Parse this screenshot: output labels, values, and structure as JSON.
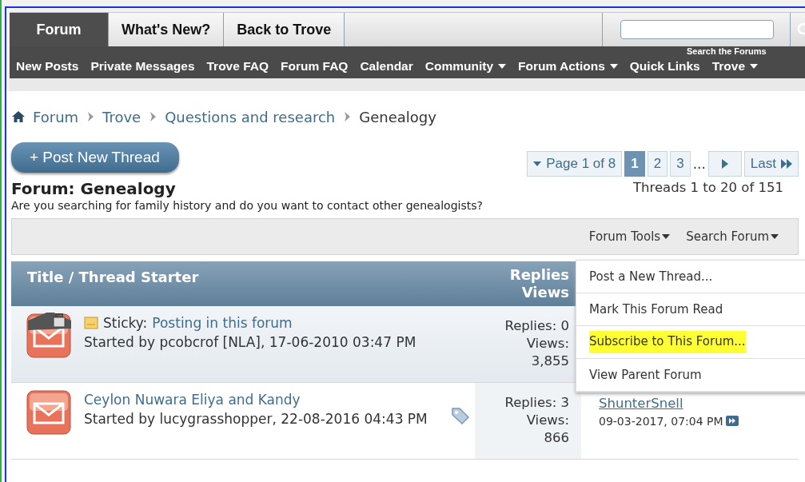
{
  "tabs": [
    {
      "label": "Forum",
      "selected": true
    },
    {
      "label": "What's New?",
      "selected": false
    },
    {
      "label": "Back to Trove",
      "selected": false
    }
  ],
  "search": {
    "overlay_label": "Search the Forums"
  },
  "nav": [
    {
      "label": "New Posts",
      "dropdown": false
    },
    {
      "label": "Private Messages",
      "dropdown": false
    },
    {
      "label": "Trove FAQ",
      "dropdown": false
    },
    {
      "label": "Forum FAQ",
      "dropdown": false
    },
    {
      "label": "Calendar",
      "dropdown": false
    },
    {
      "label": "Community",
      "dropdown": true
    },
    {
      "label": "Forum Actions",
      "dropdown": true
    },
    {
      "label": "Quick Links",
      "dropdown": false
    },
    {
      "label": "Trove",
      "dropdown": true
    }
  ],
  "breadcrumbs": [
    {
      "label": "Forum",
      "link": true
    },
    {
      "label": "Trove",
      "link": true
    },
    {
      "label": "Questions and research",
      "link": true
    },
    {
      "label": "Genealogy",
      "link": false
    }
  ],
  "post_button": "+ Post New Thread",
  "pagination": {
    "summary": "Page 1 of 8",
    "pages": [
      {
        "label": "1",
        "selected": true
      },
      {
        "label": "2",
        "selected": false
      },
      {
        "label": "3",
        "selected": false
      }
    ],
    "ellipsis": "...",
    "last": "Last",
    "range": "Threads 1 to 20 of 151"
  },
  "forum": {
    "title": "Forum: Genealogy",
    "description": "Are you searching for family history and do you want to contact other genealogists?"
  },
  "toolbar": [
    "Forum Tools",
    "Search Forum"
  ],
  "menu": [
    {
      "label": "Post a New Thread...",
      "highlighted": false
    },
    {
      "label": "Mark This Forum Read",
      "highlighted": false
    },
    {
      "label": "Subscribe to This Forum...",
      "highlighted": true
    },
    {
      "label": "View Parent Forum",
      "highlighted": false
    }
  ],
  "table": {
    "columns": [
      "Title / Thread Starter",
      "Replies",
      "Views"
    ],
    "rows": [
      {
        "sticky": true,
        "prefix": "Sticky:",
        "title": "Posting in this forum",
        "starter": "Started by pcobcrof [NLA], 17-06-2010 03:47 PM",
        "tagged": false,
        "replies": "Replies: 0",
        "views_label": "Views:",
        "views": "3,855"
      },
      {
        "sticky": false,
        "title": "Ceylon Nuwara Eliya and Kandy",
        "starter": "Started by lucygrasshopper, 22-08-2016 04:43 PM",
        "tagged": true,
        "replies": "Replies: 3",
        "views_label": "Views:",
        "views": "866",
        "last_user": "ShunterSnell",
        "last_date": "09-03-2017, 07:04 PM"
      }
    ]
  }
}
